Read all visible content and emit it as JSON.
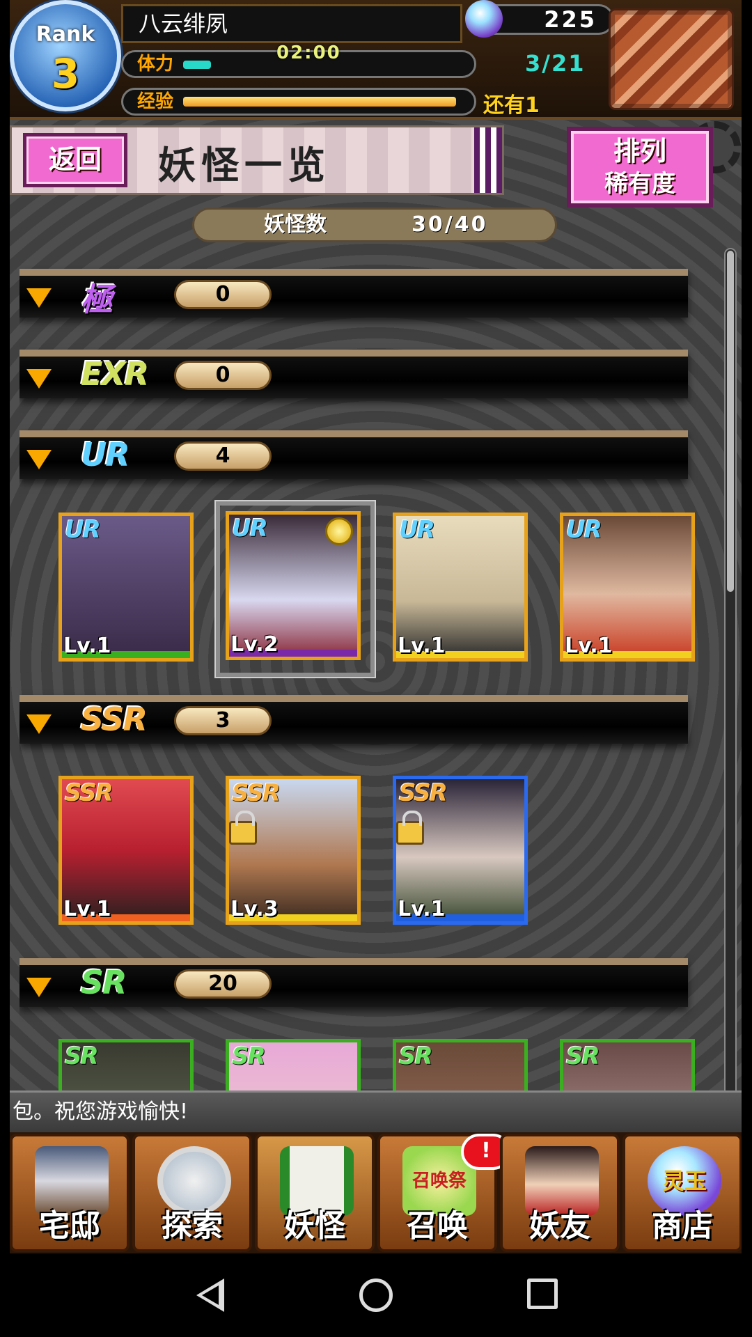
{
  "header": {
    "rank_label": "Rank",
    "rank_value": "3",
    "player_name": "八云绯夙",
    "gems": "225",
    "stamina_label": "体力",
    "stamina_timer": "02:00",
    "stamina_fill_fraction": 0.1,
    "stamina_count": "3/21",
    "exp_label": "经验",
    "exp_fill_fraction": 0.98,
    "exp_remaining": "还有1"
  },
  "title_bar": {
    "back_label": "返回",
    "title": "妖怪一览",
    "sort_line1": "排列",
    "sort_line2": "稀有度"
  },
  "counter": {
    "label": "妖怪数",
    "value": "30/40"
  },
  "sections": [
    {
      "rarity": "極",
      "count": "0",
      "color": "#c060f0"
    },
    {
      "rarity": "EXR",
      "count": "0",
      "color": "#d0e060"
    },
    {
      "rarity": "UR",
      "count": "4",
      "color": "#60d0ff"
    },
    {
      "rarity": "SSR",
      "count": "3",
      "color": "#f8b040"
    },
    {
      "rarity": "SR",
      "count": "20",
      "color": "#68e060"
    }
  ],
  "ur_cards": [
    {
      "tag": "UR",
      "level": "Lv.1",
      "bar": "#3ab020",
      "face": "#5a4a78"
    },
    {
      "tag": "UR",
      "level": "Lv.2",
      "bar": "#7a2aa8",
      "face": "#8a2a3a"
    },
    {
      "tag": "UR",
      "level": "Lv.1",
      "bar": "#f2d020",
      "face": "#d8caa8"
    },
    {
      "tag": "UR",
      "level": "Lv.1",
      "bar": "#f2d020",
      "face": "#a07058"
    }
  ],
  "ssr_cards": [
    {
      "tag": "SSR",
      "level": "Lv.1",
      "bar": "#f06020",
      "face": "#c83040"
    },
    {
      "tag": "SSR",
      "level": "Lv.3",
      "bar": "#f2d020",
      "face": "#a8b8d8"
    },
    {
      "tag": "SSR",
      "level": "Lv.1",
      "bar": "#2060e0",
      "face": "#3a3050"
    }
  ],
  "sr_cards": [
    {
      "tag": "SR",
      "face": "#4a5a48"
    },
    {
      "tag": "SR",
      "face": "#c890c0"
    },
    {
      "tag": "SR",
      "face": "#8a5a48"
    },
    {
      "tag": "SR",
      "face": "#9a7a78"
    }
  ],
  "ticker": "包。祝您游戏愉快!",
  "nav": [
    {
      "label": "宅邸",
      "icon": "mansion-icon"
    },
    {
      "label": "探索",
      "icon": "magnifier-icon"
    },
    {
      "label": "妖怪",
      "icon": "scroll-icon"
    },
    {
      "label": "召唤",
      "icon": "summon-icon",
      "alert": "!",
      "icon_text": "召唤祭"
    },
    {
      "label": "妖友",
      "icon": "catgirl-icon"
    },
    {
      "label": "商店",
      "icon": "orb-icon",
      "icon_text": "灵玉"
    }
  ]
}
